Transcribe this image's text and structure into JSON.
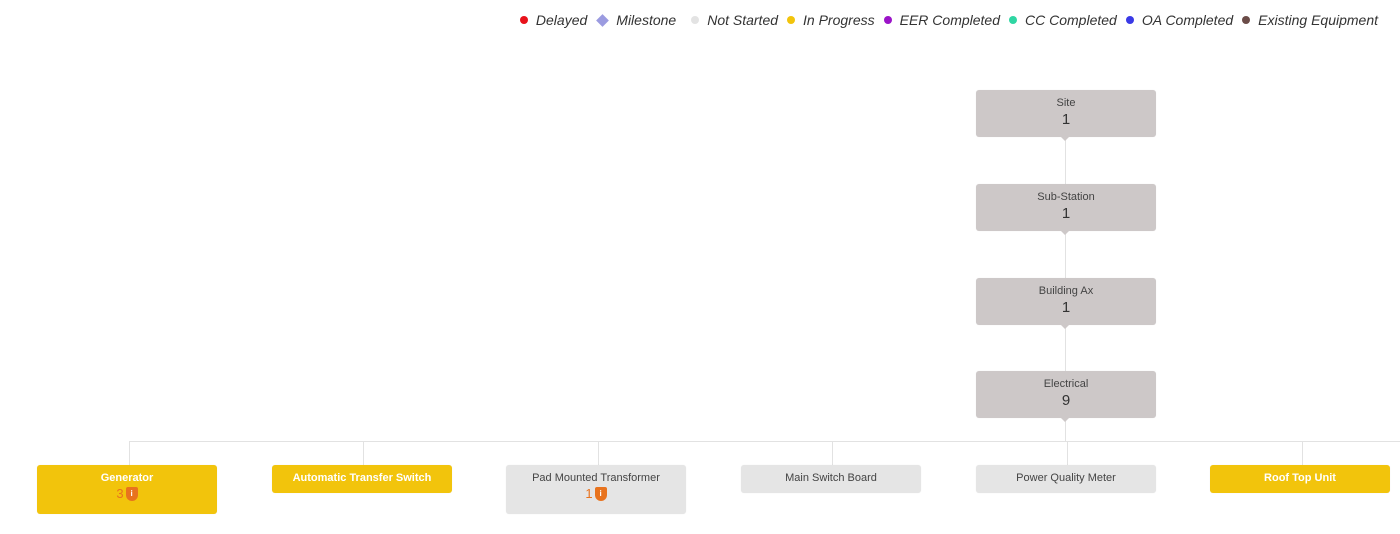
{
  "legend": [
    {
      "label": "Delayed",
      "shape": "dot",
      "color": "#e8121b"
    },
    {
      "label": "Milestone",
      "shape": "diamond",
      "color": "#9b9be0"
    },
    {
      "label": "Not Started",
      "shape": "dot",
      "color": "#e3e3e3"
    },
    {
      "label": "In Progress",
      "shape": "dot",
      "color": "#f2c40c"
    },
    {
      "label": "EER Completed",
      "shape": "dot",
      "color": "#9b14c8"
    },
    {
      "label": "CC Completed",
      "shape": "dot",
      "color": "#2fd6a3"
    },
    {
      "label": "OA Completed",
      "shape": "dot",
      "color": "#3a3ae6"
    },
    {
      "label": "Existing Equipment",
      "shape": "dot",
      "color": "#6b4c48"
    }
  ],
  "hierarchy": [
    {
      "title": "Site",
      "count": "1"
    },
    {
      "title": "Sub-Station",
      "count": "1"
    },
    {
      "title": "Building Ax",
      "count": "1"
    },
    {
      "title": "Electrical",
      "count": "9"
    }
  ],
  "children": [
    {
      "title": "Generator",
      "status": "In Progress",
      "alert_count": "3",
      "alert_icon": "shield-info-icon"
    },
    {
      "title": "Automatic Transfer Switch",
      "status": "In Progress"
    },
    {
      "title": "Pad Mounted Transformer",
      "status": "Not Started",
      "alert_count": "1",
      "alert_icon": "shield-info-icon"
    },
    {
      "title": "Main Switch Board",
      "status": "Not Started"
    },
    {
      "title": "Power Quality Meter",
      "status": "Not Started"
    },
    {
      "title": "Roof Top Unit",
      "status": "In Progress"
    }
  ]
}
